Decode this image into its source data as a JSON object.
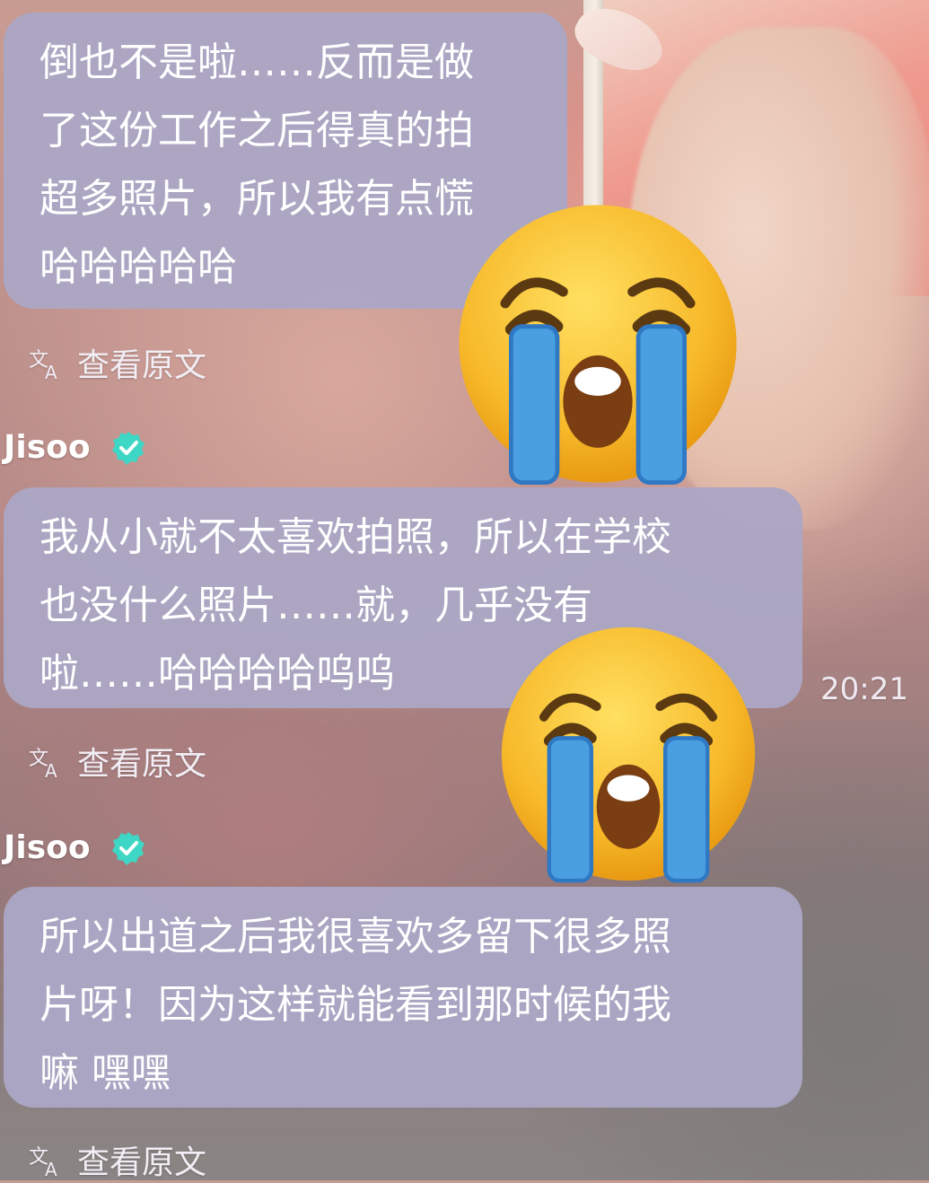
{
  "messages": [
    {
      "sender": "",
      "text": "倒也不是啦……反而是做\n了这份工作之后得真的拍\n超多照片，所以我有点慌\n哈哈哈哈哈",
      "translate_label": "查看原文"
    },
    {
      "sender": "Jisoo",
      "text": "我从小就不太喜欢拍照，所以在学校\n也没什么照片……就，几乎没有\n啦……哈哈哈哈呜呜",
      "time": "20:21",
      "translate_label": "查看原文"
    },
    {
      "sender": "Jisoo",
      "text": "所以出道之后我很喜欢多留下很多照\n片呀！因为这样就能看到那时候的我\n嘛 嘿嘿",
      "translate_label": "查看原文"
    }
  ],
  "icons": {
    "verified": "verified-check-icon",
    "translate": "translate-icon",
    "sticker": "loudly-crying-face-emoji"
  },
  "colors": {
    "bubble": "#aba7c5",
    "verified": "#3ed6c4",
    "emoji_face": "#f7b92a",
    "tears": "#4a9fe0"
  }
}
